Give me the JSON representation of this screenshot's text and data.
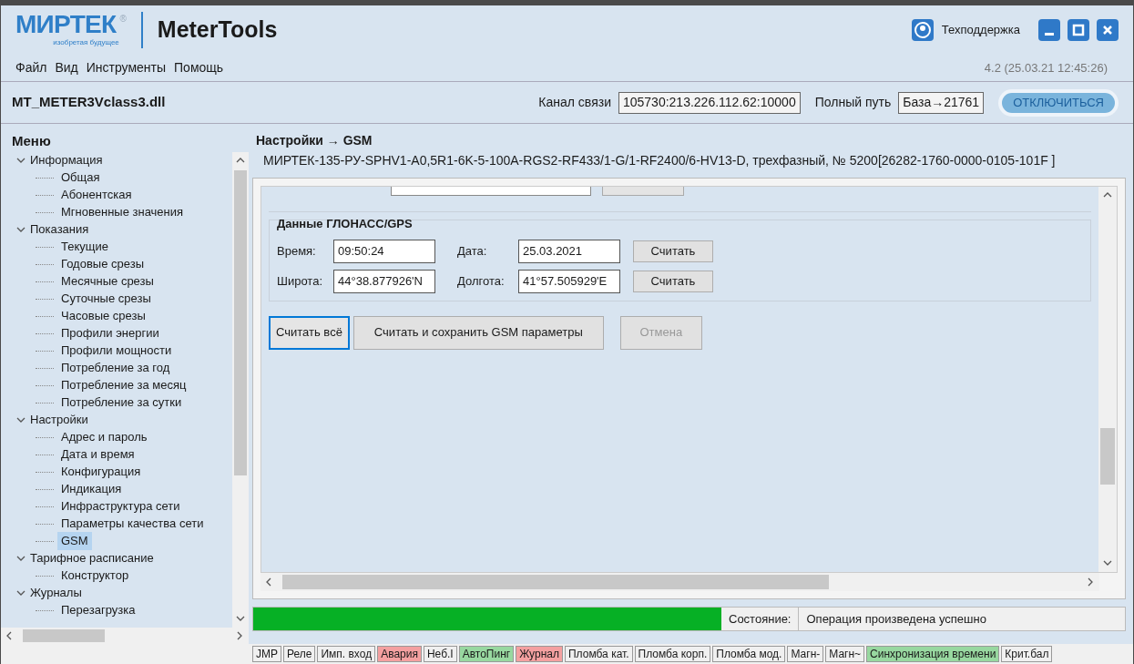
{
  "window": {
    "logo": {
      "brand": "МИРТЕК",
      "mark": "®",
      "tagline": "изобретая будущее"
    },
    "title": "MeterTools",
    "support": "Техподдержка",
    "version": "4.2 (25.03.21 12:45:26)"
  },
  "menu": [
    "Файл",
    "Вид",
    "Инструменты",
    "Помощь"
  ],
  "toolbar": {
    "driver": "MT_METER3Vclass3.dll",
    "channel_label": "Канал связи",
    "channel_value": "105730:213.226.112.62:10000",
    "path_label": "Полный путь",
    "path_value": "База→21761",
    "disconnect": "ОТКЛЮЧИТЬСЯ"
  },
  "sidebar": {
    "title": "Меню",
    "items": [
      {
        "label": "Информация",
        "expanded": true,
        "children": [
          {
            "label": "Общая",
            "selected": false
          },
          {
            "label": "Абонентская",
            "selected": false
          },
          {
            "label": "Мгновенные значения",
            "selected": false
          }
        ]
      },
      {
        "label": "Показания",
        "expanded": true,
        "children": [
          {
            "label": "Текущие",
            "selected": false
          },
          {
            "label": "Годовые срезы",
            "selected": false
          },
          {
            "label": "Месячные срезы",
            "selected": false
          },
          {
            "label": "Суточные срезы",
            "selected": false
          },
          {
            "label": "Часовые срезы",
            "selected": false
          },
          {
            "label": "Профили энергии",
            "selected": false
          },
          {
            "label": "Профили мощности",
            "selected": false
          },
          {
            "label": "Потребление за год",
            "selected": false
          },
          {
            "label": "Потребление за месяц",
            "selected": false
          },
          {
            "label": "Потребление за сутки",
            "selected": false
          }
        ]
      },
      {
        "label": "Настройки",
        "expanded": true,
        "children": [
          {
            "label": "Адрес и пароль",
            "selected": false
          },
          {
            "label": "Дата и время",
            "selected": false
          },
          {
            "label": "Конфигурация",
            "selected": false
          },
          {
            "label": "Индикация",
            "selected": false
          },
          {
            "label": "Инфраструктура сети",
            "selected": false
          },
          {
            "label": "Параметры качества сети",
            "selected": false
          },
          {
            "label": "GSM",
            "selected": true
          }
        ]
      },
      {
        "label": "Тарифное расписание",
        "expanded": true,
        "children": [
          {
            "label": "Конструктор",
            "selected": false
          }
        ]
      },
      {
        "label": "Журналы",
        "expanded": true,
        "children": [
          {
            "label": "Перезагрузка",
            "selected": false
          }
        ]
      }
    ]
  },
  "main": {
    "breadcrumb": "Настройки → GSM",
    "device": "МИРТЕК-135-РУ-SPHV1-A0,5R1-6K-5-100A-RGS2-RF433/1-G/1-RF2400/6-HV13-D, трехфазный, № 5200",
    "device_serial": "[26282-1760-0000-0105-101F ]",
    "gps": {
      "title": "Данные ГЛОНАСС/GPS",
      "rows": [
        {
          "label1": "Время:",
          "value1": "09:50:24",
          "label2": "Дата:",
          "value2": "25.03.2021",
          "button": "Считать"
        },
        {
          "label1": "Широта:",
          "value1": "44°38.877926'N",
          "label2": "Долгота:",
          "value2": "41°57.505929'E",
          "button": "Считать"
        }
      ]
    },
    "actions": [
      {
        "label": "Считать всё",
        "focused": true,
        "disabled": false
      },
      {
        "label": "Считать и сохранить GSM параметры",
        "focused": false,
        "disabled": false
      },
      {
        "label": "Отмена",
        "focused": false,
        "disabled": true
      }
    ]
  },
  "status": {
    "level": 1,
    "label": "Состояние:",
    "value": "Операция произведена успешно"
  },
  "flags": [
    {
      "label": "JMP",
      "color": "#f0f0f0"
    },
    {
      "label": "Реле",
      "color": "#f0f0f0"
    },
    {
      "label": "Имп. вход",
      "color": "#f0f0f0"
    },
    {
      "label": "Авария",
      "color": "#f4a0a0"
    },
    {
      "label": "Неб.I",
      "color": "#f0f0f0"
    },
    {
      "label": "АвтоПинг",
      "color": "#98d8a0"
    },
    {
      "label": "Журнал",
      "color": "#f4a0a0"
    },
    {
      "label": "Пломба кат.",
      "color": "#f0f0f0"
    },
    {
      "label": "Пломба корп.",
      "color": "#f0f0f0"
    },
    {
      "label": "Пломба мод.",
      "color": "#f0f0f0"
    },
    {
      "label": "Магн-",
      "color": "#f0f0f0"
    },
    {
      "label": "Магн~",
      "color": "#f0f0f0"
    },
    {
      "label": "Синхронизация времени",
      "color": "#98d8a0"
    },
    {
      "label": "Крит.бал",
      "color": "#f0f0f0"
    }
  ]
}
